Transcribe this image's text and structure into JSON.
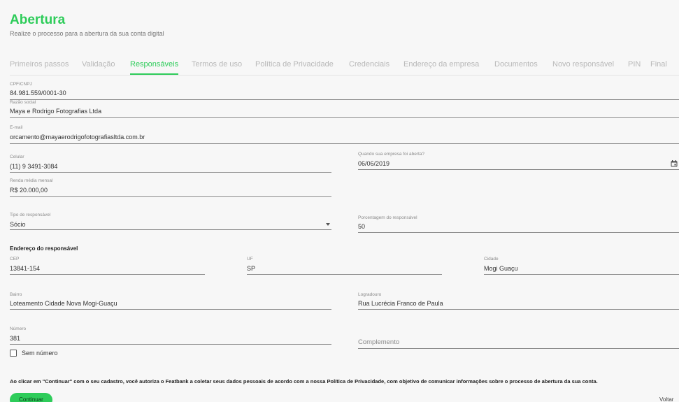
{
  "header": {
    "title": "Abertura",
    "subtitle": "Realize o processo para a abertura da sua conta digital"
  },
  "tabs": [
    {
      "label": "Primeiros passos",
      "active": false
    },
    {
      "label": "Validação",
      "active": false
    },
    {
      "label": "Responsáveis",
      "active": true
    },
    {
      "label": "Termos de uso",
      "active": false
    },
    {
      "label": "Política de Privacidade",
      "active": false
    },
    {
      "label": "Credenciais",
      "active": false
    },
    {
      "label": "Endereço da empresa",
      "active": false
    },
    {
      "label": "Documentos",
      "active": false
    },
    {
      "label": "Novo responsável",
      "active": false
    },
    {
      "label": "PIN",
      "active": false
    },
    {
      "label": "Final",
      "active": false
    }
  ],
  "form": {
    "cpf_cnpj": {
      "label": "CPF/CNPJ",
      "value": "84.981.559/0001-30"
    },
    "razao_social": {
      "label": "Razão social",
      "value": "Maya e Rodrigo Fotografias Ltda"
    },
    "email": {
      "label": "E-mail",
      "value": "orcamento@mayaerodrigofotografiasltda.com.br"
    },
    "celular": {
      "label": "Celular",
      "value": "(11) 9 3491-3084"
    },
    "data_abertura": {
      "label": "Quando sua empresa foi aberta?",
      "value": "06/06/2019",
      "icon": "calendar-icon"
    },
    "renda": {
      "label": "Renda média mensal",
      "value": "R$ 20.000,00"
    },
    "tipo_responsavel": {
      "label": "Tipo de responsável",
      "value": "Sócio",
      "icon": "chevron-down-icon"
    },
    "porcentagem": {
      "label": "Porcentagem do responsável",
      "value": "50"
    }
  },
  "endereco": {
    "title": "Endereço do responsável",
    "cep": {
      "label": "CEP",
      "value": "13841-154"
    },
    "uf": {
      "label": "UF",
      "value": "SP"
    },
    "cidade": {
      "label": "Cidade",
      "value": "Mogi Guaçu"
    },
    "bairro": {
      "label": "Bairro",
      "value": "Loteamento Cidade Nova Mogi-Guaçu"
    },
    "logradouro": {
      "label": "Logradouro",
      "value": "Rua Lucrécia Franco de Paula"
    },
    "numero": {
      "label": "Número",
      "value": "381"
    },
    "complemento": {
      "placeholder": "Complemento"
    },
    "sem_numero": {
      "label": "Sem número",
      "checked": false
    }
  },
  "consent_text": "Ao clicar em \"Continuar\" com o seu cadastro, você autoriza o Featbank a coletar seus dados pessoais de acordo com a nossa Política de Privacidade, com objetivo de comunicar informações sobre o processo de abertura da sua conta.",
  "actions": {
    "continue_label": "Continuar",
    "back_label": "Voltar"
  },
  "colors": {
    "accent": "#2ecc5a",
    "background": "#f7f7f7"
  }
}
